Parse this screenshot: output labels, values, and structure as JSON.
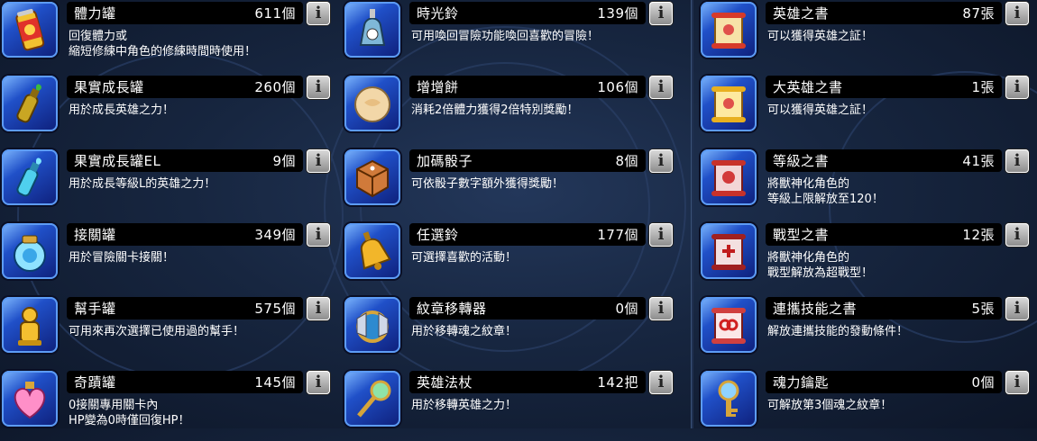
{
  "col1": [
    {
      "name": "體力罐",
      "count": "611個",
      "desc": "回復體力或\n縮短修練中角色的修練時間時使用！",
      "icon": "stamina-can-icon"
    },
    {
      "name": "果實成長罐",
      "count": "260個",
      "desc": "用於成長英雄之力！",
      "icon": "fruit-growth-bottle-icon"
    },
    {
      "name": "果實成長罐EL",
      "count": "9個",
      "desc": "用於成長等級L的英雄之力！",
      "icon": "fruit-growth-bottle-el-icon"
    },
    {
      "name": "接關罐",
      "count": "349個",
      "desc": "用於冒險關卡接關！",
      "icon": "continue-jar-icon"
    },
    {
      "name": "幫手罐",
      "count": "575個",
      "desc": "可用來再次選擇已使用過的幫手！",
      "icon": "helper-can-icon"
    },
    {
      "name": "奇蹟罐",
      "count": "145個",
      "desc": "0接關專用關卡內\nHP變為0時僅回復HP！",
      "icon": "miracle-jar-icon"
    }
  ],
  "col2": [
    {
      "name": "時光鈴",
      "count": "139個",
      "desc": "可用喚回冒險功能喚回喜歡的冒險！",
      "icon": "time-bell-icon"
    },
    {
      "name": "增增餅",
      "count": "106個",
      "desc": "消耗2倍體力獲得2倍特別獎勵！",
      "icon": "double-cookie-icon"
    },
    {
      "name": "加碼骰子",
      "count": "8個",
      "desc": "可依骰子數字額外獲得獎勵！",
      "icon": "bonus-dice-icon"
    },
    {
      "name": "任選鈴",
      "count": "177個",
      "desc": "可選擇喜歡的活動！",
      "icon": "choice-bell-icon"
    },
    {
      "name": "紋章移轉器",
      "count": "0個",
      "desc": "用於移轉魂之紋章！",
      "icon": "crest-transfer-icon"
    },
    {
      "name": "英雄法杖",
      "count": "142把",
      "desc": "用於移轉英雄之力！",
      "icon": "hero-staff-icon"
    }
  ],
  "col3": [
    {
      "name": "英雄之書",
      "count": "87張",
      "desc": "可以獲得英雄之証！",
      "icon": "hero-scroll-icon"
    },
    {
      "name": "大英雄之書",
      "count": "1張",
      "desc": "可以獲得英雄之証！",
      "icon": "great-hero-scroll-icon"
    },
    {
      "name": "等級之書",
      "count": "41張",
      "desc": "將獸神化角色的\n等級上限解放至120！",
      "icon": "level-scroll-icon"
    },
    {
      "name": "戰型之書",
      "count": "12張",
      "desc": "將獸神化角色的\n戰型解放為超戰型！",
      "icon": "battle-type-scroll-icon"
    },
    {
      "name": "連攜技能之書",
      "count": "5張",
      "desc": "解放連攜技能的發動條件！",
      "icon": "link-skill-scroll-icon"
    },
    {
      "name": "魂力鑰匙",
      "count": "0個",
      "desc": "可解放第3個魂之紋章！",
      "icon": "soul-key-icon"
    }
  ],
  "info_label": "i"
}
